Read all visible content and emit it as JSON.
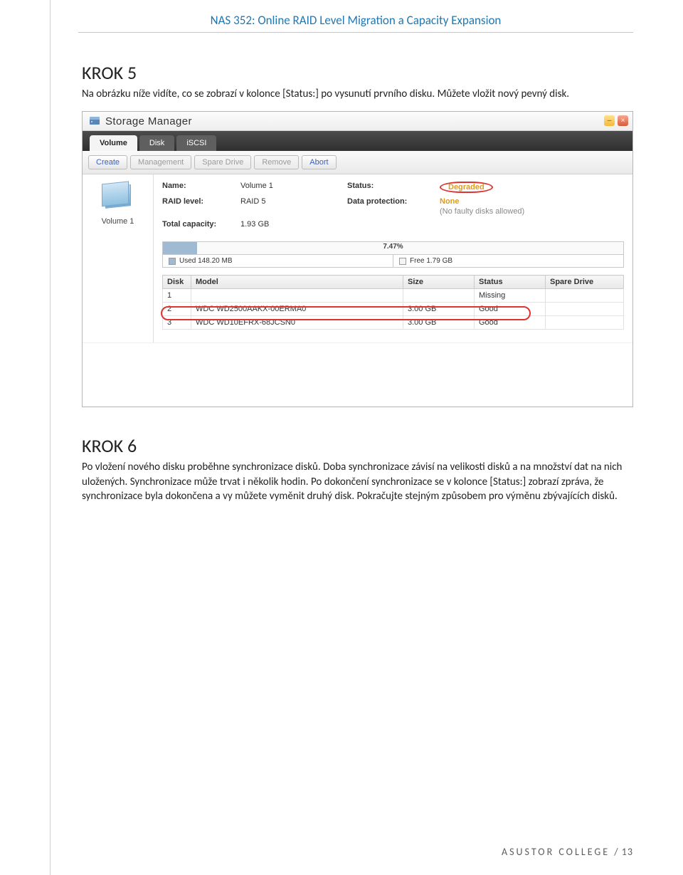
{
  "header": {
    "title": "NAS 352: Online RAID Level Migration a Capacity Expansion"
  },
  "step5": {
    "heading": "KROK 5",
    "text": "Na obrázku níže vidíte, co se zobrazí v kolonce [Status:] po vysunutí prvního disku. Můžete vložit nový pevný disk."
  },
  "window": {
    "title": "Storage Manager",
    "tabs": {
      "volume": "Volume",
      "disk": "Disk",
      "iscsi": "iSCSI"
    },
    "toolbar": {
      "create": "Create",
      "management": "Management",
      "spare": "Spare Drive",
      "remove": "Remove",
      "abort": "Abort"
    },
    "sidebar": {
      "volume_label": "Volume 1"
    },
    "info": {
      "name_label": "Name:",
      "name_value": "Volume 1",
      "raid_label": "RAID level:",
      "raid_value": "RAID 5",
      "cap_label": "Total capacity:",
      "cap_value": "1.93 GB",
      "status_label": "Status:",
      "status_value": "Degraded",
      "dp_label": "Data protection:",
      "dp_value": "None",
      "dp_sub": "(No faulty disks allowed)"
    },
    "usage": {
      "pct": "7.47%",
      "used_label": "Used 148.20 MB",
      "free_label": "Free 1.79 GB"
    },
    "columns": {
      "disk": "Disk",
      "model": "Model",
      "size": "Size",
      "status": "Status",
      "spare": "Spare Drive"
    },
    "rows": [
      {
        "disk": "1",
        "model": "",
        "size": "",
        "status": "Missing",
        "spare": ""
      },
      {
        "disk": "2",
        "model": "WDC WD2500AAKX-00ERMA0",
        "size": "3.00 GB",
        "status": "Good",
        "spare": ""
      },
      {
        "disk": "3",
        "model": "WDC WD10EFRX-68JCSN0",
        "size": "3.00 GB",
        "status": "Good",
        "spare": ""
      }
    ]
  },
  "step6": {
    "heading": "KROK 6",
    "text": "Po vložení nového disku proběhne synchronizace disků. Doba synchronizace závisí na velikosti disků a na množství dat na nich uložených. Synchronizace může trvat i několik hodin. Po dokončení synchronizace se v kolonce [Status:] zobrazí zpráva, že synchronizace byla dokončena a vy můžete vyměnit druhý disk. Pokračujte stejným způsobem pro výměnu zbývajících disků."
  },
  "footer": {
    "left": "ASUSTOR COLLEGE",
    "right": "/ 13"
  },
  "chart_data": {
    "type": "bar",
    "title": "Volume 1 capacity usage",
    "categories": [
      "Used",
      "Free"
    ],
    "values_gb": [
      0.145,
      1.79
    ],
    "percent_used": 7.47,
    "total_gb": 1.93
  }
}
